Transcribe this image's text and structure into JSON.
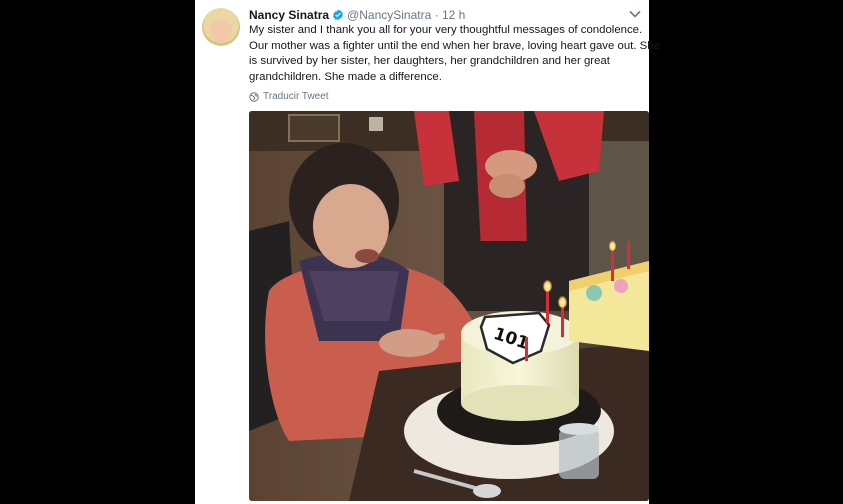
{
  "tweet": {
    "display_name": "Nancy Sinatra",
    "handle": "@NancySinatra",
    "separator": "·",
    "timestamp": "12 h",
    "text_lines": [
      "My sister and I thank you all for your very thoughtful messages of condolence.",
      "Our mother was a fighter until the end when her brave, loving heart gave out. She",
      "is survived by her sister, her daughters, her grandchildren and her great",
      "grandchildren. She made a difference."
    ],
    "translate_label": "Traducir Tweet",
    "photo_cake_text": "101"
  },
  "colors": {
    "verified_badge": "#1da1f2",
    "secondary_text": "#657786",
    "primary_text": "#14171a"
  },
  "icons": [
    "verified-badge-icon",
    "chevron-down-icon",
    "globe-icon"
  ]
}
